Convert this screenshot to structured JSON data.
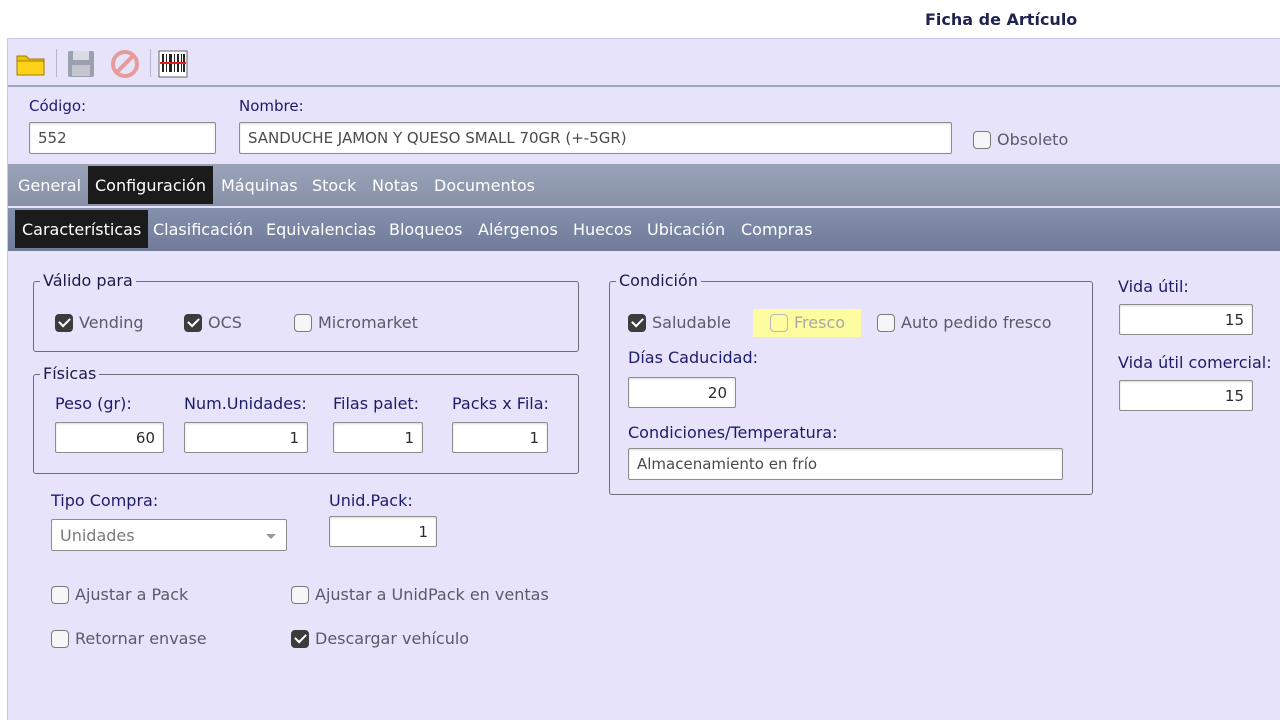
{
  "window": {
    "title": "Ficha de Artículo"
  },
  "toolbar": {
    "open_icon": "folder-icon",
    "save_icon": "floppy-disk-icon",
    "cancel_icon": "cancel-icon",
    "barcode_icon": "barcode-icon"
  },
  "header": {
    "codigo_label": "Código:",
    "codigo_value": "552",
    "nombre_label": "Nombre:",
    "nombre_value": "SANDUCHE JAMON Y QUESO SMALL 70GR (+-5GR)",
    "obsoleto_label": "Obsoleto",
    "obsoleto_checked": false
  },
  "main_tabs": [
    {
      "label": "General",
      "active": false
    },
    {
      "label": "Configuración",
      "active": true
    },
    {
      "label": "Máquinas",
      "active": false
    },
    {
      "label": "Stock",
      "active": false
    },
    {
      "label": "Notas",
      "active": false
    },
    {
      "label": "Documentos",
      "active": false
    }
  ],
  "sub_tabs": [
    {
      "label": "Características",
      "active": true
    },
    {
      "label": "Clasificación",
      "active": false
    },
    {
      "label": "Equivalencias",
      "active": false
    },
    {
      "label": "Bloqueos",
      "active": false
    },
    {
      "label": "Alérgenos",
      "active": false
    },
    {
      "label": "Huecos",
      "active": false
    },
    {
      "label": "Ubicación",
      "active": false
    },
    {
      "label": "Compras",
      "active": false
    }
  ],
  "valido_para": {
    "legend": "Válido para",
    "items": [
      {
        "label": "Vending",
        "checked": true
      },
      {
        "label": "OCS",
        "checked": true
      },
      {
        "label": "Micromarket",
        "checked": false
      }
    ]
  },
  "fisicas": {
    "legend": "Físicas",
    "fields": [
      {
        "label": "Peso (gr):",
        "value": "60"
      },
      {
        "label": "Num.Unidades:",
        "value": "1"
      },
      {
        "label": "Filas palet:",
        "value": "1"
      },
      {
        "label": "Packs x Fila:",
        "value": "1"
      }
    ]
  },
  "tipo_compra": {
    "label": "Tipo Compra:",
    "value": "Unidades"
  },
  "unid_pack": {
    "label": "Unid.Pack:",
    "value": "1"
  },
  "options": [
    {
      "label": "Ajustar a Pack",
      "checked": false
    },
    {
      "label": "Ajustar a UnidPack en ventas",
      "checked": false
    },
    {
      "label": "Retornar envase",
      "checked": false
    },
    {
      "label": "Descargar vehículo",
      "checked": true
    }
  ],
  "condicion": {
    "legend": "Condición",
    "saludable": {
      "label": "Saludable",
      "checked": true
    },
    "fresco": {
      "label": "Fresco",
      "checked": false,
      "highlight_color": "#fdfda0"
    },
    "auto_pedido": {
      "label": "Auto pedido fresco",
      "checked": false
    },
    "dias_caducidad_label": "Días Caducidad:",
    "dias_caducidad_value": "20",
    "condiciones_label": "Condiciones/Temperatura:",
    "condiciones_value": "Almacenamiento en frío"
  },
  "vida": {
    "vida_util_label": "Vida útil:",
    "vida_util_value": "15",
    "vida_util_comercial_label": "Vida útil comercial:",
    "vida_util_comercial_value": "15"
  },
  "colors": {
    "background": "#e6e3fb",
    "active_tab": "#1b1b1b",
    "tab_bar": "#8791a8",
    "label_text": "#1c1c6a"
  }
}
